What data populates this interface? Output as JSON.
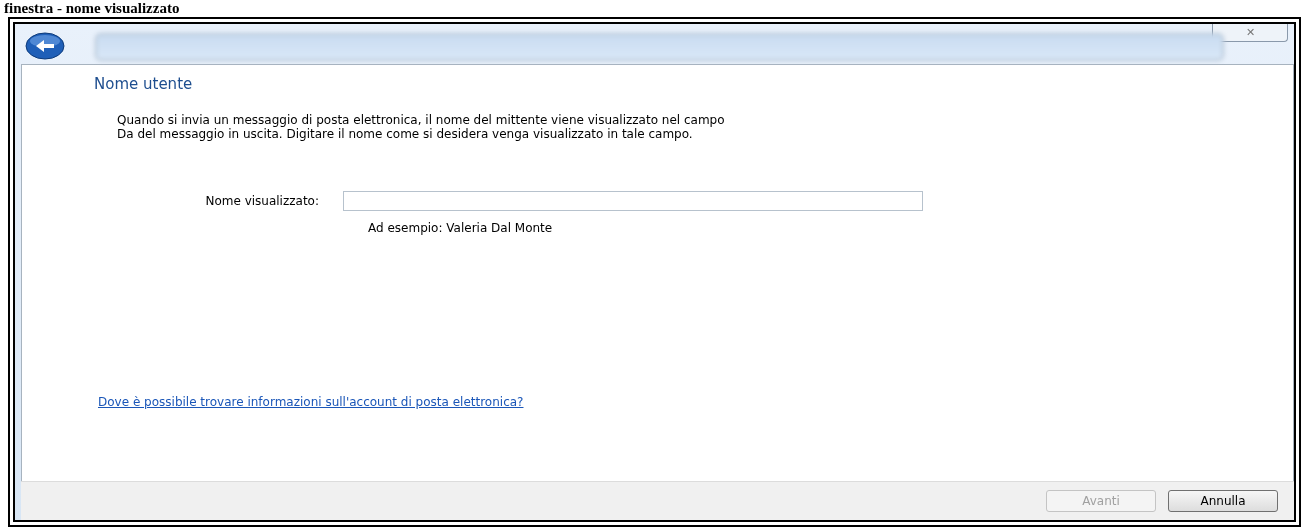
{
  "caption": "finestra - nome visualizzato",
  "window": {
    "close_label": "✕"
  },
  "page": {
    "heading": "Nome utente",
    "description": "Quando si invia un messaggio di posta elettronica, il nome del mittente viene visualizzato nel campo Da del messaggio in uscita. Digitare il nome come si desidera venga visualizzato in tale campo.",
    "field": {
      "label": "Nome visualizzato:",
      "hint": "Ad esempio: Valeria Dal Monte"
    },
    "link": "Dove è possibile trovare informazioni sull'account di posta elettronica?"
  },
  "buttons": [
    {
      "label": "Avanti",
      "disabled": true
    },
    {
      "label": "Annulla",
      "disabled": false
    }
  ]
}
